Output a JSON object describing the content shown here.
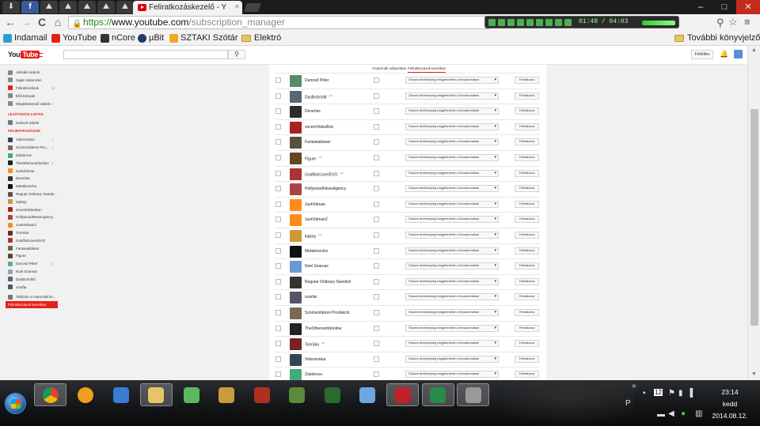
{
  "browser": {
    "tab_title": "Feliratkozáskezelő - Y",
    "tab_close": "×",
    "url_scheme": "https://",
    "url_host": "www.youtube.com",
    "url_path": "/subscription_manager",
    "back": "←",
    "forward": "→",
    "reload": "C",
    "home": "⌂",
    "min": "–",
    "max": "□",
    "close": "✕",
    "media_time": "01:48 / 04:03",
    "bookmarks": [
      {
        "label": "Indamail",
        "color": "#2a9fd6"
      },
      {
        "label": "YouTube",
        "color": "#e62117"
      },
      {
        "label": "nCore",
        "color": "#333333"
      },
      {
        "label": "µBit",
        "color": "#1e3a70"
      },
      {
        "label": "SZTAKI Szótár",
        "color": "#f5a623"
      },
      {
        "label": "Elektró",
        "color": "folder"
      }
    ],
    "other_bookmarks": "További könyvjelzők"
  },
  "youtube": {
    "logo_you": "You",
    "logo_tube": "Tube",
    "search_button": "⚲",
    "upload_label": "Feltöltés",
    "bell": "🔔",
    "guide": {
      "top_items": [
        {
          "label": "Aktiváló videók",
          "count": ""
        },
        {
          "label": "Saját csatornám",
          "count": ""
        },
        {
          "label": "Feliratkozások",
          "count": "11"
        },
        {
          "label": "Előzmények",
          "count": ""
        },
        {
          "label": "Megtekintendő videók",
          "count": "1"
        }
      ],
      "playlists_heading": "LEJÁTSZÁSI LISTÁK",
      "playlist_items": [
        {
          "label": "Kedvelt videók"
        }
      ],
      "subs_heading": "FELIRATKOZÁSOK",
      "subs_items": [
        {
          "label": "Videomania",
          "count": "1",
          "color": "#345"
        },
        {
          "label": "Szomszédenni Pro...",
          "count": "1",
          "color": "#7a6a55"
        },
        {
          "label": "Zaldorvos",
          "count": "",
          "color": "#4a7"
        },
        {
          "label": "TheOtherworldonline",
          "count": "1",
          "color": "#222"
        },
        {
          "label": "JustVidman",
          "count": "",
          "color": "#ff8c1a"
        },
        {
          "label": "Deverlas",
          "count": "",
          "color": "#333"
        },
        {
          "label": "Metalexovlos",
          "count": "",
          "color": "#111"
        },
        {
          "label": "Reguar Ordinary Swede...",
          "count": "",
          "color": "#555"
        },
        {
          "label": "Kipkay",
          "count": "",
          "color": "#c93"
        },
        {
          "label": "escentVideoBon",
          "count": "",
          "color": "#a22"
        },
        {
          "label": "HollywoodNewsAgency",
          "count": "",
          "color": "#a44"
        },
        {
          "label": "JustVidman2",
          "count": "",
          "color": "#ff8c1a"
        },
        {
          "label": "TomSka",
          "count": "",
          "color": "#722"
        },
        {
          "label": "GoldfishLiveVEVO",
          "count": "",
          "color": "#a33"
        },
        {
          "label": "Fantasiablaser",
          "count": "",
          "color": "#665"
        },
        {
          "label": "Figure",
          "count": "",
          "color": "#664422"
        },
        {
          "label": "Danosd Péter",
          "count": "1",
          "color": "#6a8"
        },
        {
          "label": "Noel Szarvas",
          "count": "",
          "color": "#8ab"
        },
        {
          "label": "DasBoSchitt",
          "count": "",
          "color": "#567"
        },
        {
          "label": "szarfar",
          "count": "",
          "color": "#556"
        }
      ],
      "bottom_items": [
        {
          "label": "Tallózás a csatornák kö..."
        }
      ],
      "active_item": "Feliratkozások kezelése"
    },
    "columns": {
      "channel": "Csatornák választása",
      "subscriptions": "Feliratkozások kezelése"
    },
    "select_text": "Összes tevékenység megjelenítése a hírcsatornában",
    "unsubscribe_label": "Feliratkozva",
    "rows": [
      {
        "name": "Danosd Péter",
        "badge": "",
        "color": "#5a8a6a"
      },
      {
        "name": "DasBoSchitt",
        "badge": "HD",
        "color": "#556677"
      },
      {
        "name": "Deverlas",
        "badge": "",
        "color": "#2b2b2b"
      },
      {
        "name": "escentVideoBon",
        "badge": "",
        "color": "#aa2222"
      },
      {
        "name": "Fantasiablaser",
        "badge": "",
        "color": "#5a5040"
      },
      {
        "name": "Figure",
        "badge": "HD",
        "color": "#664422"
      },
      {
        "name": "GoldfishLiveVEVO",
        "badge": "HD",
        "color": "#aa3333"
      },
      {
        "name": "HollywoodNewsAgency",
        "badge": "",
        "color": "#aa4444"
      },
      {
        "name": "JustVidman",
        "badge": "",
        "color": "#ff8c1a"
      },
      {
        "name": "JustVidman2",
        "badge": "",
        "color": "#ff8c1a"
      },
      {
        "name": "kipkay",
        "badge": "HD",
        "color": "#cc9933"
      },
      {
        "name": "Metalexovlos",
        "badge": "",
        "color": "#111111"
      },
      {
        "name": "Noel Szarvas",
        "badge": "",
        "color": "#6a9ad6"
      },
      {
        "name": "Regular Ordinary Swedish",
        "badge": "",
        "color": "#333333"
      },
      {
        "name": "szarfar",
        "badge": "",
        "color": "#555566"
      },
      {
        "name": "Szomszédenni Produkció",
        "badge": "",
        "color": "#7a6a55"
      },
      {
        "name": "TheOtherworldonline",
        "badge": "",
        "color": "#222222"
      },
      {
        "name": "TomSka",
        "badge": "HD",
        "color": "#772222"
      },
      {
        "name": "Videománia",
        "badge": "",
        "color": "#334455"
      },
      {
        "name": "Zaldorvos",
        "badge": "",
        "color": "#44aa77"
      }
    ]
  },
  "taskbar": {
    "apps": [
      {
        "name": "chrome",
        "color": "#e94b3c",
        "active": true
      },
      {
        "name": "aimp",
        "color": "#f0a020",
        "active": false
      },
      {
        "name": "media",
        "color": "#3a7bd5",
        "active": false
      },
      {
        "name": "folder",
        "color": "#e8c468",
        "active": true
      },
      {
        "name": "sims",
        "color": "#5cb85c",
        "active": false
      },
      {
        "name": "game-gold",
        "color": "#c89b3c",
        "active": false
      },
      {
        "name": "game-red",
        "color": "#b03020",
        "active": false
      },
      {
        "name": "minecraft",
        "color": "#5a8a3a",
        "active": false
      },
      {
        "name": "tree",
        "color": "#2a6a2a",
        "active": false
      },
      {
        "name": "swirl",
        "color": "#6aa6e0",
        "active": false
      },
      {
        "name": "red-app",
        "color": "#c0202a",
        "active": true
      },
      {
        "name": "green-app",
        "color": "#2a8a4a",
        "active": true
      },
      {
        "name": "gear-app",
        "color": "#999999",
        "active": true
      }
    ],
    "tray_expand": "»",
    "tray_badge": "12",
    "lang": "P",
    "time": "23:14",
    "day": "kedd",
    "date": "2014.08.12."
  }
}
